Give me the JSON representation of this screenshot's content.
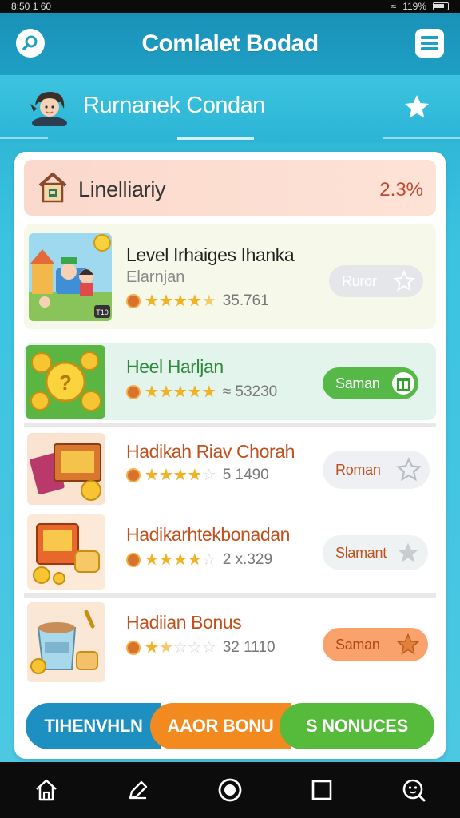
{
  "status_bar": {
    "time": "8:50 1 60",
    "signal_text": "119%"
  },
  "app_bar": {
    "title": "Comlalet Bodad",
    "left_icon": "search-icon",
    "right_icon": "menu-icon"
  },
  "sub_header": {
    "title": "Rurnanek Condan",
    "right_icon": "star-icon"
  },
  "summary": {
    "label": "Linelliariy",
    "value": "2.3%"
  },
  "items": [
    {
      "name": "Level Irhaiges Ihanka",
      "subtitle": "Elarnjan",
      "rating": 4.5,
      "rating_value": "35.761",
      "button": "Ruror",
      "thumb_badge": "T10"
    },
    {
      "name": "Heel Harljan",
      "rating": 5,
      "rating_value": "≈ 53230",
      "button": "Saman"
    },
    {
      "name": "Hadikah Riav Chorah",
      "rating": 4,
      "rating_value": "5 1490",
      "button": "Roman"
    },
    {
      "name": "Hadikarhtekbonadan",
      "rating": 4,
      "rating_value": "2 x.329",
      "button": "Slamant"
    },
    {
      "name": "Hadiian Bonus",
      "rating": 1.5,
      "rating_value": "32 1110",
      "button": "Saman"
    }
  ],
  "segments": [
    {
      "label": "TIHENVHLN",
      "color": "#1d8fc0"
    },
    {
      "label": "AAOR BONU",
      "color": "#f38a1f"
    },
    {
      "label": "S  NONUCES",
      "color": "#56bb3b"
    }
  ],
  "nav": [
    "home-icon",
    "edit-icon",
    "circle-home-icon",
    "square-icon",
    "search-face-icon"
  ],
  "colors": {
    "accent": "#1f9fc4",
    "summary_value": "#c4482e",
    "green_pill": "#55b847",
    "orange_pill": "#f9a26b"
  }
}
